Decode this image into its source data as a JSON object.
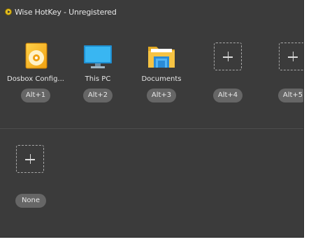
{
  "window": {
    "title": "Wise HotKey - Unregistered"
  },
  "shortcuts": [
    {
      "label": "Dosbox Config...",
      "key": "Alt+1",
      "icon": "disc-icon"
    },
    {
      "label": "This PC",
      "key": "Alt+2",
      "icon": "monitor-icon"
    },
    {
      "label": "Documents",
      "key": "Alt+3",
      "icon": "folder-icon"
    },
    {
      "label": "",
      "key": "Alt+4",
      "icon": "add-icon"
    },
    {
      "label": "",
      "key": "Alt+5",
      "icon": "add-icon"
    }
  ],
  "unassigned": {
    "key": "None",
    "icon": "add-icon"
  },
  "colors": {
    "background": "#3b3b3b",
    "pill": "#666666",
    "text": "#e8e8e8"
  }
}
